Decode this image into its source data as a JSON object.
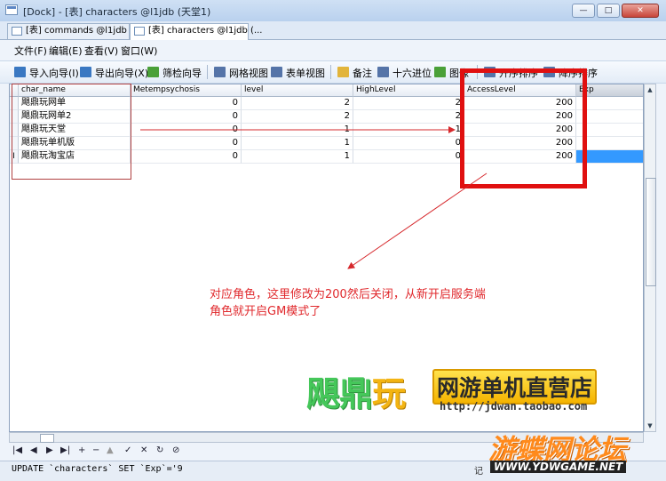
{
  "window": {
    "title": "[Dock] - [表] characters @l1jdb (天堂1)",
    "minimize": "—",
    "maximize": "□",
    "close": "✕"
  },
  "tabs": [
    {
      "label": "[表] commands @l1jdb (..."
    },
    {
      "label": "[表] characters @l1jdb (..."
    }
  ],
  "menu": [
    {
      "label": "文件(F)"
    },
    {
      "label": "编辑(E)"
    },
    {
      "label": "查看(V)"
    },
    {
      "label": "窗口(W)"
    }
  ],
  "toolbar": [
    {
      "label": "导入向导(I)",
      "icon": "import-icon",
      "color": "#3a78c2"
    },
    {
      "label": "导出向导(X)",
      "icon": "export-icon",
      "color": "#3a78c2"
    },
    {
      "label": "筛检向导",
      "icon": "filter-icon",
      "color": "#4aa038"
    },
    {
      "label": "网格视图",
      "icon": "grid-view-icon",
      "color": "#5574a8"
    },
    {
      "label": "表单视图",
      "icon": "form-view-icon",
      "color": "#5574a8"
    },
    {
      "label": "备注",
      "icon": "memo-icon",
      "color": "#e2b43a"
    },
    {
      "label": "十六进位",
      "icon": "hex-icon",
      "color": "#5574a8"
    },
    {
      "label": "图像",
      "icon": "image-icon",
      "color": "#4aa038"
    },
    {
      "label": "升序排序",
      "icon": "sort-asc-icon",
      "color": "#5574a8"
    },
    {
      "label": "降序排序",
      "icon": "sort-desc-icon",
      "color": "#5574a8"
    }
  ],
  "table": {
    "columns": [
      "char_name",
      "Metempsychosis",
      "level",
      "HighLevel",
      "AccessLevel",
      "Exp"
    ],
    "rows": [
      [
        "飓鼎玩网单",
        "0",
        "2",
        "2",
        "200",
        ""
      ],
      [
        "飓鼎玩网单2",
        "0",
        "2",
        "2",
        "200",
        ""
      ],
      [
        "飓鼎玩天堂",
        "0",
        "1",
        "1",
        "200",
        ""
      ],
      [
        "飓鼎玩单机版",
        "0",
        "1",
        "0",
        "200",
        ""
      ],
      [
        "飓鼎玩淘宝店",
        "0",
        "1",
        "0",
        "200",
        ""
      ]
    ],
    "current_row_marker": "I"
  },
  "navigator": [
    "|◀",
    "◀",
    "▶",
    "▶|",
    "+",
    "−",
    "▲",
    "✓",
    "✕",
    "↻",
    "⊘"
  ],
  "status": {
    "sql": "UPDATE `characters` SET `Exp`='9",
    "record_label": "记"
  },
  "annotation": {
    "line1": "对应角色，这里修改为200然后关闭，从新开启服务端",
    "line2": "角色就开启GM模式了",
    "color": "#e0282c"
  },
  "branding": {
    "name_part1": "飓鼎",
    "name_part2": "玩",
    "shop": "网游单机直营店",
    "url": "http://jdwan.taobao.com"
  },
  "watermark": {
    "name": "游蝶网论坛",
    "url": "WWW.YDWGAME.NET"
  },
  "colors": {
    "selection": "#3399ff",
    "highlight_box": "#e01010"
  }
}
